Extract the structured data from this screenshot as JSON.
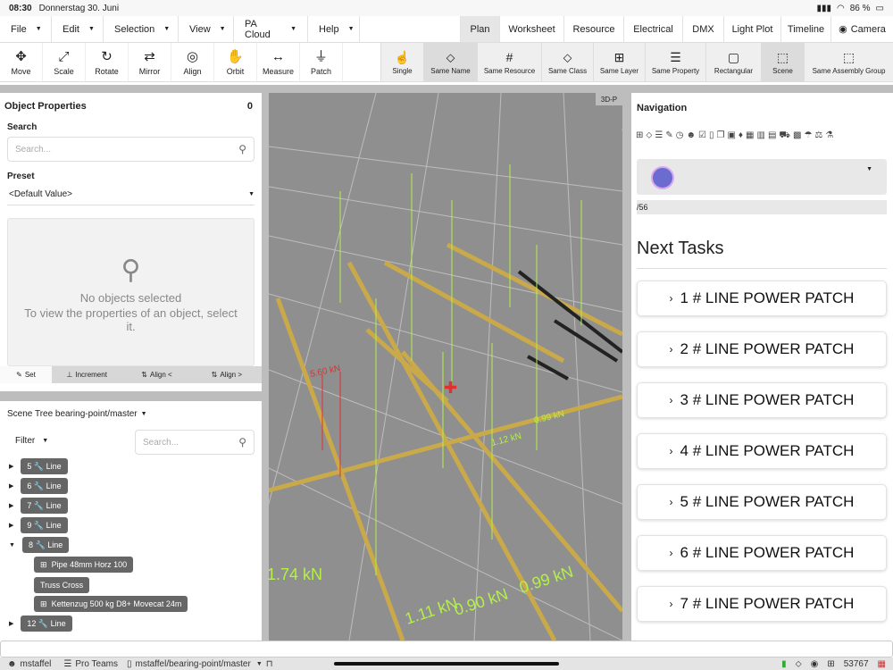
{
  "status": {
    "time": "08:30",
    "date": "Donnerstag 30. Juni",
    "battery": "86 %"
  },
  "menus": [
    {
      "label": "File"
    },
    {
      "label": "Edit"
    },
    {
      "label": "Selection"
    },
    {
      "label": "View"
    },
    {
      "label": "PA Cloud"
    },
    {
      "label": "Help"
    }
  ],
  "views": [
    {
      "label": "Plan",
      "active": true
    },
    {
      "label": "Worksheet"
    },
    {
      "label": "Resource"
    },
    {
      "label": "Electrical"
    },
    {
      "label": "DMX"
    },
    {
      "label": "Light Plot"
    },
    {
      "label": "Timeline"
    },
    {
      "label": "Camera",
      "icon": "camera-icon"
    }
  ],
  "tools": [
    {
      "label": "Move",
      "icon": "move-icon",
      "glyph": "✥"
    },
    {
      "label": "Scale",
      "icon": "scale-icon",
      "glyph": "⤢"
    },
    {
      "label": "Rotate",
      "icon": "rotate-icon",
      "glyph": "↻"
    },
    {
      "label": "Mirror",
      "icon": "mirror-icon",
      "glyph": "⇄"
    },
    {
      "label": "Align",
      "icon": "align-icon",
      "glyph": "◎"
    },
    {
      "label": "Orbit",
      "icon": "hand-icon",
      "glyph": "✋"
    },
    {
      "label": "Measure",
      "icon": "measure-icon",
      "glyph": "↔"
    },
    {
      "label": "Patch",
      "icon": "plug-icon",
      "glyph": "⏚"
    }
  ],
  "select_modes": [
    {
      "label": "Single",
      "icon": "pointer-icon",
      "glyph": "☝"
    },
    {
      "label": "Same Name",
      "icon": "tag-icon",
      "glyph": "⬦",
      "active": true
    },
    {
      "label": "Same Resource",
      "icon": "hash-icon",
      "glyph": "#"
    },
    {
      "label": "Same Class",
      "icon": "tags-icon",
      "glyph": "⬦"
    },
    {
      "label": "Same Layer",
      "icon": "hierarchy-icon",
      "glyph": "⊞"
    },
    {
      "label": "Same Property",
      "icon": "list-icon",
      "glyph": "☰"
    },
    {
      "label": "Rectangular",
      "icon": "rectangle-icon",
      "glyph": "▢"
    },
    {
      "label": "Scene",
      "icon": "scene-icon",
      "glyph": "⬚",
      "active": true
    },
    {
      "label": "Same Assembly Group",
      "icon": "group-icon",
      "glyph": "⬚"
    }
  ],
  "object_properties": {
    "title": "Object Properties",
    "count": "0",
    "search_label": "Search",
    "search_placeholder": "Search...",
    "preset_label": "Preset",
    "preset_value": "<Default Value>",
    "empty_title": "No objects selected",
    "empty_text": "To view the properties of an object, select it.",
    "actions": [
      {
        "label": "Set",
        "icon": "pencil-icon"
      },
      {
        "label": "Increment",
        "icon": "pin-icon"
      },
      {
        "label": "Align <",
        "icon": "sort-icon"
      },
      {
        "label": "Align >",
        "icon": "sort-icon"
      }
    ]
  },
  "scene_tree": {
    "title": "Scene Tree bearing-point/master",
    "filter_label": "Filter",
    "search_placeholder": "Search...",
    "rows": [
      {
        "num": "5",
        "label": "Line"
      },
      {
        "num": "6",
        "label": "Line"
      },
      {
        "num": "7",
        "label": "Line"
      },
      {
        "num": "9",
        "label": "Line"
      },
      {
        "num": "8",
        "label": "Line",
        "expanded": true
      },
      {
        "num": "12",
        "label": "Line"
      }
    ],
    "children": [
      {
        "label": "Pipe 48mm Horz 100"
      },
      {
        "label": "Truss Cross"
      },
      {
        "label": "Kettenzug 500 kg D8+ Movecat 24m"
      }
    ]
  },
  "viewport": {
    "mode_label": "3D-P",
    "loads": [
      "1.74 kN",
      "1.11 kN",
      "0.90 kN",
      "0.99 kN",
      "1.12 kN",
      "0.99 kN",
      "5.60 kN"
    ]
  },
  "navigation": {
    "title": "Navigation",
    "progress": "/56",
    "next_tasks_title": "Next Tasks",
    "tasks": [
      {
        "label": "1 # LINE POWER PATCH"
      },
      {
        "label": "2 # LINE POWER PATCH"
      },
      {
        "label": "3 # LINE POWER PATCH"
      },
      {
        "label": "4 # LINE POWER PATCH"
      },
      {
        "label": "5 # LINE POWER PATCH"
      },
      {
        "label": "6 # LINE POWER PATCH"
      },
      {
        "label": "7 # LINE POWER PATCH"
      }
    ]
  },
  "footer": {
    "user": "mstaffel",
    "team": "Pro Teams",
    "branch": "mstaffel/bearing-point/master",
    "count": "53767"
  }
}
